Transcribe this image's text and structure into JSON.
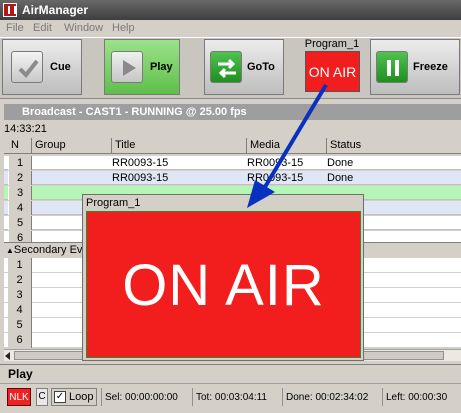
{
  "app": {
    "title": "AirManager"
  },
  "menu": [
    "File",
    "Edit",
    "Window",
    "Help"
  ],
  "toolbar": {
    "cue_label": "Cue",
    "play_label": "Play",
    "goto_label": "GoTo",
    "freeze_label": "Freeze",
    "program_label": "Program_1",
    "on_air_text": "ON AIR"
  },
  "broadcast": {
    "header": "Broadcast - CAST1 - RUNNING @ 25.00 fps",
    "time": "14:33:21",
    "columns": [
      "N",
      "Group",
      "Title",
      "Media",
      "Status"
    ],
    "rows": [
      {
        "n": "1",
        "group": "",
        "title": "RR0093-15",
        "media": "RR0093-15",
        "status": "Done"
      },
      {
        "n": "2",
        "group": "",
        "title": "RR0093-15",
        "media": "RR0093-15",
        "status": "Done"
      },
      {
        "n": "3",
        "group": "",
        "title": "",
        "media": "",
        "status": ""
      },
      {
        "n": "4",
        "group": "",
        "title": "",
        "media": "",
        "status": ""
      },
      {
        "n": "5",
        "group": "",
        "title": "",
        "media": "",
        "status": ""
      },
      {
        "n": "6",
        "group": "",
        "title": "",
        "media": "",
        "status": ""
      }
    ],
    "active_row_color": "#b5f5b5",
    "selected_row_color": "#dfe6f5"
  },
  "secondary": {
    "header": "Secondary Ev",
    "rows": [
      "1",
      "2",
      "3",
      "4",
      "5",
      "6"
    ]
  },
  "overlay": {
    "title": "Program_1",
    "text": "ON AIR",
    "color": "#f21d1d"
  },
  "status": {
    "mode": "Play",
    "nlk": "NLK",
    "c": "C",
    "loop": "Loop",
    "loop_checked": true,
    "sel": "Sel: 00:00:00:00",
    "tot": "Tot: 00:03:04:11",
    "done": "Done: 00:02:34:02",
    "left": "Left: 00:00:30"
  },
  "colors": {
    "accent_blue": "#0a30c0",
    "on_air_red": "#f21d1d",
    "play_green": "#7fd46a"
  }
}
